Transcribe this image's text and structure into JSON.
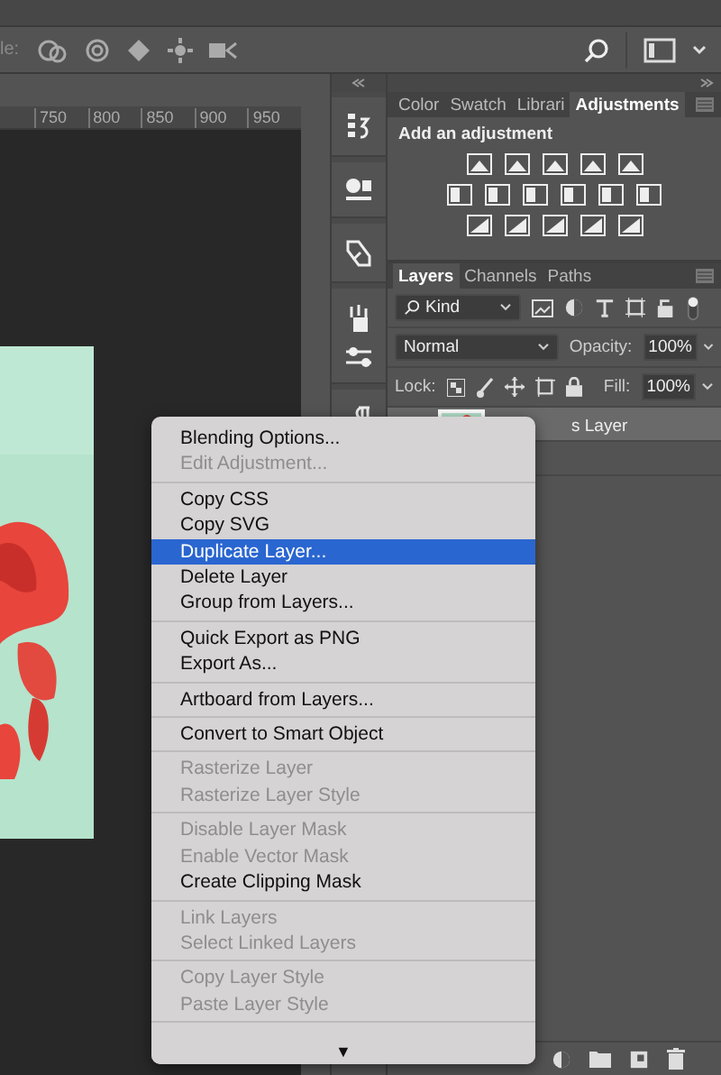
{
  "options_bar": {
    "label": "le:"
  },
  "ruler": {
    "ticks": [
      "750",
      "800",
      "850",
      "900",
      "950"
    ]
  },
  "adjustments_panel": {
    "tabs": [
      {
        "label": "Color",
        "selected": false
      },
      {
        "label": "Swatch",
        "selected": false
      },
      {
        "label": "Librari",
        "selected": false
      },
      {
        "label": "Adjustments",
        "selected": true
      }
    ],
    "heading": "Add an adjustment"
  },
  "layers_panel": {
    "tabs": [
      {
        "label": "Layers",
        "selected": true
      },
      {
        "label": "Channels",
        "selected": false
      },
      {
        "label": "Paths",
        "selected": false
      }
    ],
    "filter": "Kind",
    "blend_mode": "Normal",
    "opacity_label": "Opacity:",
    "opacity": "100%",
    "lock_label": "Lock:",
    "fill_label": "Fill:",
    "fill": "100%",
    "layers": [
      {
        "name": "s Layer",
        "selected": true
      }
    ]
  },
  "context_menu": {
    "groups": [
      [
        {
          "label": "Blending Options...",
          "disabled": false,
          "selected": false
        },
        {
          "label": "Edit Adjustment...",
          "disabled": true,
          "selected": false
        }
      ],
      [
        {
          "label": "Copy CSS",
          "disabled": false,
          "selected": false
        },
        {
          "label": "Copy SVG",
          "disabled": false,
          "selected": false
        },
        {
          "label": "Duplicate Layer...",
          "disabled": false,
          "selected": true
        },
        {
          "label": "Delete Layer",
          "disabled": false,
          "selected": false
        },
        {
          "label": "Group from Layers...",
          "disabled": false,
          "selected": false
        }
      ],
      [
        {
          "label": "Quick Export as PNG",
          "disabled": false,
          "selected": false
        },
        {
          "label": "Export As...",
          "disabled": false,
          "selected": false
        }
      ],
      [
        {
          "label": "Artboard from Layers...",
          "disabled": false,
          "selected": false
        }
      ],
      [
        {
          "label": "Convert to Smart Object",
          "disabled": false,
          "selected": false
        }
      ],
      [
        {
          "label": "Rasterize Layer",
          "disabled": true,
          "selected": false
        },
        {
          "label": "Rasterize Layer Style",
          "disabled": true,
          "selected": false
        }
      ],
      [
        {
          "label": "Disable Layer Mask",
          "disabled": true,
          "selected": false
        },
        {
          "label": "Enable Vector Mask",
          "disabled": true,
          "selected": false
        },
        {
          "label": "Create Clipping Mask",
          "disabled": false,
          "selected": false
        }
      ],
      [
        {
          "label": "Link Layers",
          "disabled": true,
          "selected": false
        },
        {
          "label": "Select Linked Layers",
          "disabled": true,
          "selected": false
        }
      ],
      [
        {
          "label": "Copy Layer Style",
          "disabled": true,
          "selected": false
        },
        {
          "label": "Paste Layer Style",
          "disabled": true,
          "selected": false
        }
      ]
    ],
    "scroll_arrow": "▼"
  }
}
